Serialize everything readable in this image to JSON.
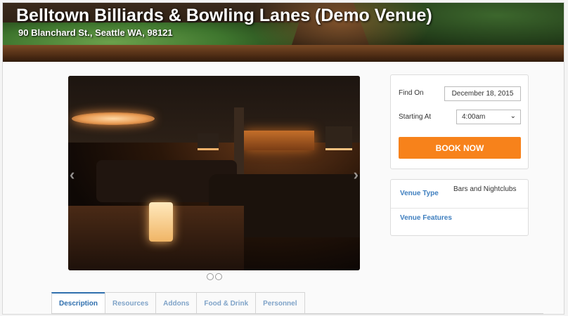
{
  "venue": {
    "title": "Belltown Billiards & Bowling Lanes (Demo Venue)",
    "address": "90 Blanchard St., Seattle WA, 98121"
  },
  "carousel": {
    "prev_icon": "‹",
    "next_icon": "›",
    "slide_count": 2,
    "active_slide": 1
  },
  "tabs": [
    {
      "label": "Description",
      "active": true
    },
    {
      "label": "Resources",
      "active": false
    },
    {
      "label": "Addons",
      "active": false
    },
    {
      "label": "Food & Drink",
      "active": false
    },
    {
      "label": "Personnel",
      "active": false
    }
  ],
  "booking": {
    "find_on_label": "Find On",
    "date_value": "December 18, 2015",
    "starting_at_label": "Starting At",
    "time_value": "4:00am",
    "book_label": "BOOK NOW",
    "accent_color": "#f7821b"
  },
  "venue_info": {
    "type_label": "Venue Type",
    "type_value": "Bars and Nightclubs",
    "features_label": "Venue Features",
    "features_value": ""
  }
}
